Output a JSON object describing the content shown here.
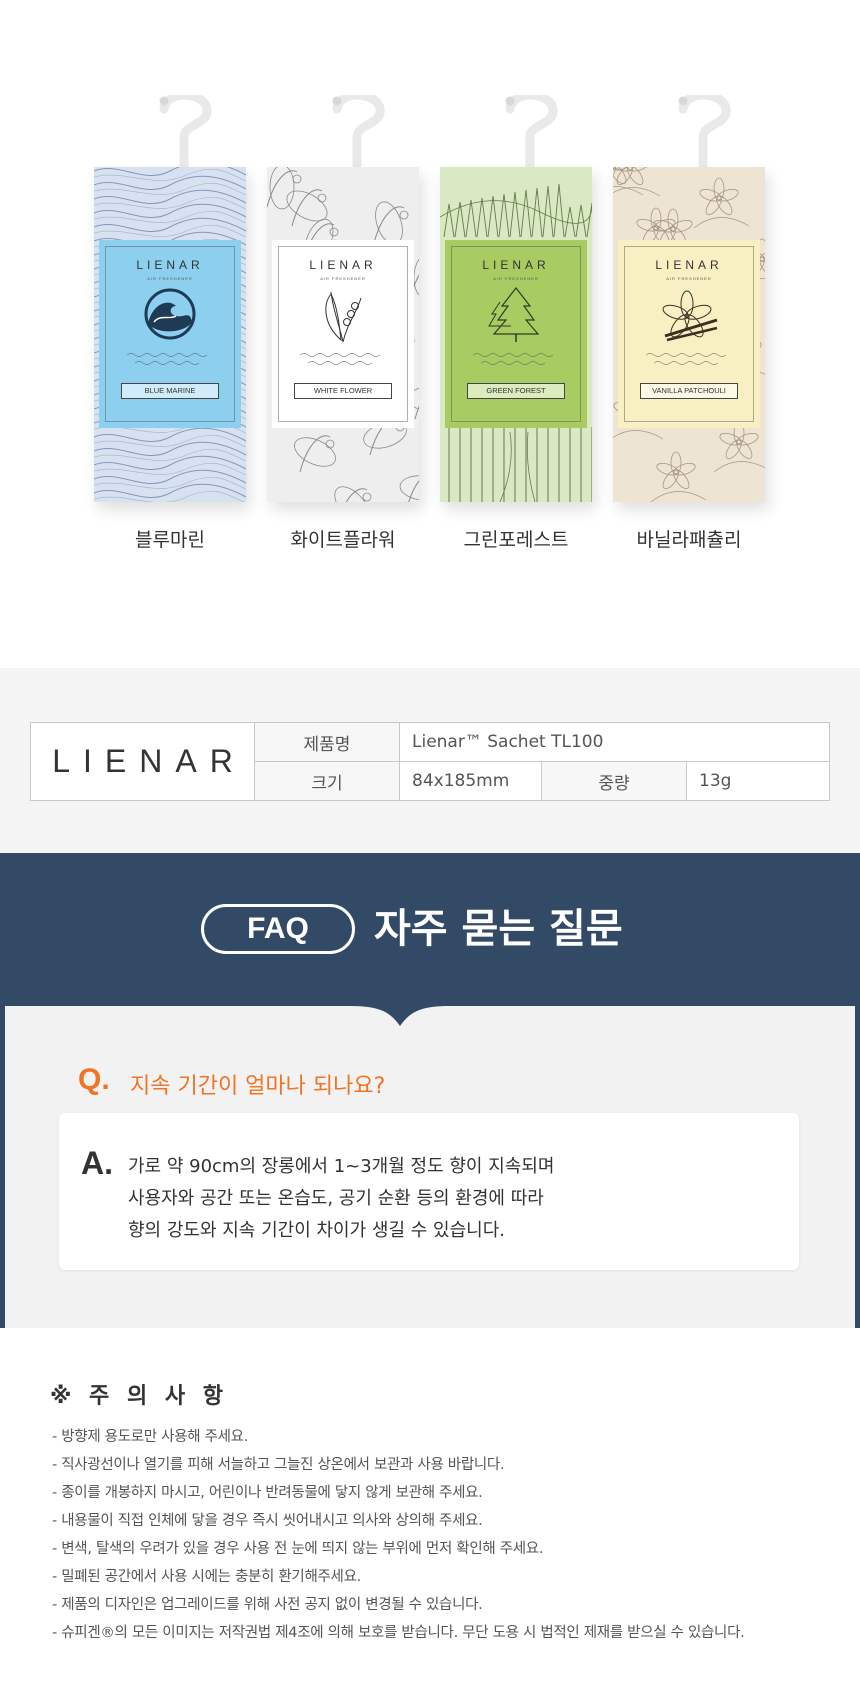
{
  "products": [
    {
      "brand": "LIENAR",
      "brand_sub": "AIR FRESHENER",
      "variant": "BLUE MARINE",
      "name": "블루마린",
      "colors": {
        "label": "#8ccfee",
        "pattern_bg": "#d7e1ef",
        "pattern_line": "#6b7fa8"
      },
      "illustration_icon": "wave-icon"
    },
    {
      "brand": "LIENAR",
      "brand_sub": "AIR FRESHENER",
      "variant": "WHITE FLOWER",
      "name": "화이트플라워",
      "colors": {
        "label": "#ffffff",
        "pattern_bg": "#eeeeee",
        "pattern_line": "#8a8a8a"
      },
      "illustration_icon": "lily-of-the-valley-icon"
    },
    {
      "brand": "LIENAR",
      "brand_sub": "AIR FRESHENER",
      "variant": "GREEN FOREST",
      "name": "그린포레스트",
      "colors": {
        "label": "#a8cc62",
        "pattern_bg": "#dbe8c4",
        "pattern_line": "#5f7e46"
      },
      "illustration_icon": "pine-tree-icon"
    },
    {
      "brand": "LIENAR",
      "brand_sub": "AIR FRESHENER",
      "variant": "VANILLA PATCHOULI",
      "name": "바닐라패츌리",
      "colors": {
        "label": "#f8f0c3",
        "pattern_bg": "#ede4d4",
        "pattern_line": "#a89682"
      },
      "illustration_icon": "vanilla-flower-icon"
    }
  ],
  "spec": {
    "logo": "LIENAR",
    "rows": [
      {
        "label": "제품명",
        "value": "Lienar™ Sachet TL100"
      },
      {
        "label": "크기",
        "value": "84x185mm",
        "label2": "중량",
        "value2": "13g"
      }
    ]
  },
  "faq": {
    "badge": "FAQ",
    "title": "자주 묻는 질문",
    "q_mark": "Q.",
    "question": "지속 기간이 얼마나 되나요?",
    "a_mark": "A.",
    "answer_lines": [
      "가로 약 90cm의 장롱에서 1~3개월 정도 향이 지속되며",
      "사용자와 공간 또는 온습도, 공기 순환 등의 환경에 따라",
      "향의 강도와 지속 기간이 차이가 생길 수 있습니다."
    ],
    "colors": {
      "header_bg": "#334a66",
      "panel_bg": "#f2f2f2",
      "accent": "#f07423"
    }
  },
  "caution": {
    "title": "※ 주 의 사 항",
    "items": [
      "- 방향제 용도로만 사용해 주세요.",
      "- 직사광선이나 열기를 피해 서늘하고 그늘진 상온에서 보관과 사용 바랍니다.",
      "- 종이를 개봉하지 마시고, 어린이나 반려동물에 닿지 않게 보관해 주세요.",
      "- 내용물이 직접 인체에 닿을 경우 즉시 씻어내시고 의사와 상의해 주세요.",
      "- 변색, 탈색의 우려가 있을 경우 사용 전 눈에 띄지 않는 부위에 먼저 확인해 주세요.",
      "- 밀폐된 공간에서 사용 시에는 충분히 환기해주세요.",
      "- 제품의 디자인은 업그레이드를 위해 사전 공지 없이 변경될 수 있습니다.",
      "- 슈피겐®의 모든 이미지는 저작권법 제4조에 의해 보호를 받습니다. 무단 도용 시 법적인 제재를 받으실 수 있습니다."
    ]
  }
}
